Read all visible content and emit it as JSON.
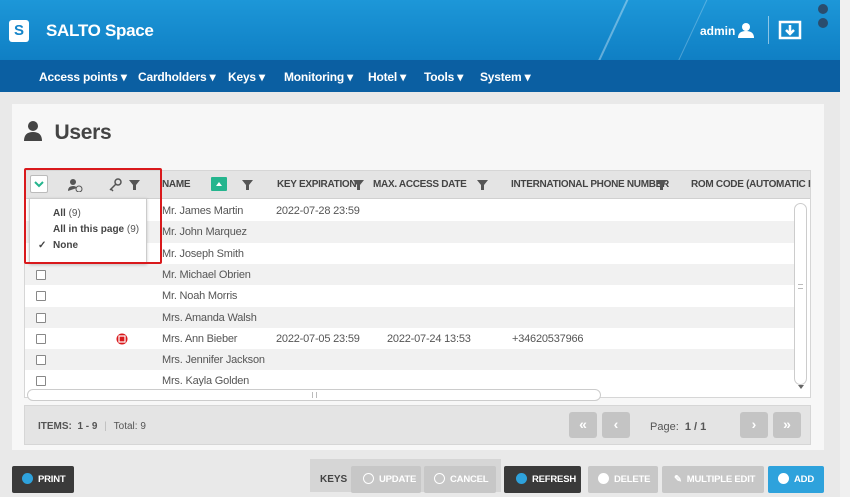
{
  "app": {
    "logo_letter": "S",
    "name": "SALTO Space",
    "user": "admin"
  },
  "colors": {
    "topbar": "#1384c9",
    "navbar": "#0b5fa2",
    "accent": "#2ea2dc",
    "red": "#d9191c",
    "teal": "#25b58e"
  },
  "nav": [
    "Access points",
    "Cardholders",
    "Keys",
    "Monitoring",
    "Hotel",
    "Tools",
    "System"
  ],
  "page": {
    "title": "Users"
  },
  "grid": {
    "columns": [
      "NAME",
      "KEY EXPIRATION",
      "MAX. ACCESS DATE",
      "INTERNATIONAL PHONE NUMBER",
      "ROM CODE (AUTOMATIC I"
    ],
    "rows": [
      {
        "name": "Mr. James Martin",
        "key_expiration": "2022-07-28 23:59",
        "max_access": "",
        "phone": ""
      },
      {
        "name": "Mr. John Marquez",
        "key_expiration": "",
        "max_access": "",
        "phone": ""
      },
      {
        "name": "Mr. Joseph Smith",
        "key_expiration": "",
        "max_access": "",
        "phone": ""
      },
      {
        "name": "Mr. Michael Obrien",
        "key_expiration": "",
        "max_access": "",
        "phone": ""
      },
      {
        "name": "Mr. Noah Morris",
        "key_expiration": "",
        "max_access": "",
        "phone": ""
      },
      {
        "name": "Mrs. Amanda Walsh",
        "key_expiration": "",
        "max_access": "",
        "phone": ""
      },
      {
        "name": "Mrs. Ann Bieber",
        "key_expiration": "2022-07-05 23:59",
        "max_access": "2022-07-24 13:53",
        "phone": "+34620537966"
      },
      {
        "name": "Mrs. Jennifer Jackson",
        "key_expiration": "",
        "max_access": "",
        "phone": ""
      },
      {
        "name": "Mrs. Kayla Golden",
        "key_expiration": "",
        "max_access": "",
        "phone": ""
      }
    ]
  },
  "select_popup": {
    "all": "All",
    "all_count": "(9)",
    "page": "All in this page",
    "page_count": "(9)",
    "none": "None",
    "check": "✓"
  },
  "footer": {
    "items_label": "ITEMS:",
    "items_range": "1 - 9",
    "total": "Total: 9",
    "page_label": "Page:",
    "page_value": "1 / 1"
  },
  "buttons": {
    "print": "PRINT",
    "keys": "KEYS",
    "update": "UPDATE",
    "cancel": "CANCEL",
    "refresh": "REFRESH",
    "delete": "DELETE",
    "multiple_edit": "MULTIPLE EDIT",
    "add": "ADD"
  }
}
